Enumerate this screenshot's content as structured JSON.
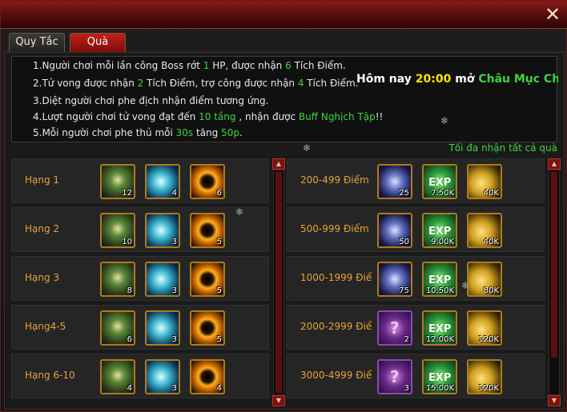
{
  "window": {
    "close_glyph": "✕"
  },
  "tabs": [
    {
      "label": "Quy Tắc",
      "active": false
    },
    {
      "label": "Quà",
      "active": true
    }
  ],
  "rules": [
    {
      "parts": [
        "1.Người chơi mỗi lần công Boss rớt ",
        "1",
        " HP, được nhận ",
        "6",
        " Tích Điểm."
      ]
    },
    {
      "parts": [
        "2.Tử vong được nhận ",
        "2",
        " Tích Điểm, trợ công được nhận ",
        "4",
        " Tích Điểm."
      ]
    },
    {
      "parts": [
        "3.Diệt người chơi phe địch nhận điểm tương ứng."
      ]
    },
    {
      "parts": [
        "4.Lượt người chơi tử vong đạt đến ",
        "10 tầng",
        " , nhận được ",
        "Buff Nghịch Tập",
        "!!"
      ]
    },
    {
      "parts": [
        "5.Mỗi người chơi phe thủ mỗi ",
        "30s",
        " tăng ",
        "50p",
        "."
      ]
    }
  ],
  "announcement": {
    "prefix": "Hôm nay ",
    "time": "20:00",
    "middle": " mở ",
    "event": "Châu Mục Chiế"
  },
  "claim_all": "Tối đa nhận tất cả quà",
  "rank_rewards": [
    {
      "label": "Hạng 1",
      "items": [
        {
          "icon": "armor-icon",
          "count": "12"
        },
        {
          "icon": "card-icon",
          "count": "4"
        },
        {
          "icon": "ring-icon",
          "count": "6"
        }
      ]
    },
    {
      "label": "Hạng 2",
      "items": [
        {
          "icon": "armor-icon",
          "count": "10"
        },
        {
          "icon": "card-icon",
          "count": "3"
        },
        {
          "icon": "ring-icon",
          "count": "5"
        }
      ]
    },
    {
      "label": "Hạng 3",
      "items": [
        {
          "icon": "armor-icon",
          "count": "8"
        },
        {
          "icon": "card-icon",
          "count": "3"
        },
        {
          "icon": "ring-icon",
          "count": "5"
        }
      ]
    },
    {
      "label": "Hạng4-5",
      "items": [
        {
          "icon": "armor-icon",
          "count": "6"
        },
        {
          "icon": "card-icon",
          "count": "3"
        },
        {
          "icon": "ring-icon",
          "count": "5"
        }
      ]
    },
    {
      "label": "Hạng 6-10",
      "items": [
        {
          "icon": "armor-icon",
          "count": "4"
        },
        {
          "icon": "card-icon",
          "count": "3"
        },
        {
          "icon": "ring-icon",
          "count": "4"
        }
      ]
    }
  ],
  "point_rewards": [
    {
      "label": "200-499 Điểm",
      "items": [
        {
          "icon": "badge-icon",
          "count": "25"
        },
        {
          "icon": "exp-icon",
          "count": "7.50K"
        },
        {
          "icon": "coin-icon",
          "count": "40K"
        }
      ]
    },
    {
      "label": "500-999 Điểm",
      "items": [
        {
          "icon": "badge-icon",
          "count": "50"
        },
        {
          "icon": "exp-icon",
          "count": "9.00K"
        },
        {
          "icon": "coin-icon",
          "count": "40K"
        }
      ]
    },
    {
      "label": "1000-1999 Điể",
      "items": [
        {
          "icon": "badge-icon",
          "count": "75"
        },
        {
          "icon": "exp-icon",
          "count": "10.50K"
        },
        {
          "icon": "coin-icon",
          "count": "80K"
        }
      ]
    },
    {
      "label": "2000-2999 Điể",
      "items": [
        {
          "icon": "mystery-box-icon",
          "count": "2"
        },
        {
          "icon": "exp-icon",
          "count": "12.00K"
        },
        {
          "icon": "coin-icon",
          "count": "120K"
        }
      ]
    },
    {
      "label": "3000-4999 Điể",
      "items": [
        {
          "icon": "mystery-box-icon",
          "count": "3"
        },
        {
          "icon": "exp-icon",
          "count": "15.00K"
        },
        {
          "icon": "coin-icon",
          "count": "120K"
        }
      ]
    }
  ],
  "icon_text": {
    "exp": "EXP",
    "mystery": "?"
  },
  "colors": {
    "accent_green": "#3fd33f",
    "label_orange": "#e8a13a",
    "title_red": "#8a1a17",
    "announce_yellow": "#ffe600"
  }
}
